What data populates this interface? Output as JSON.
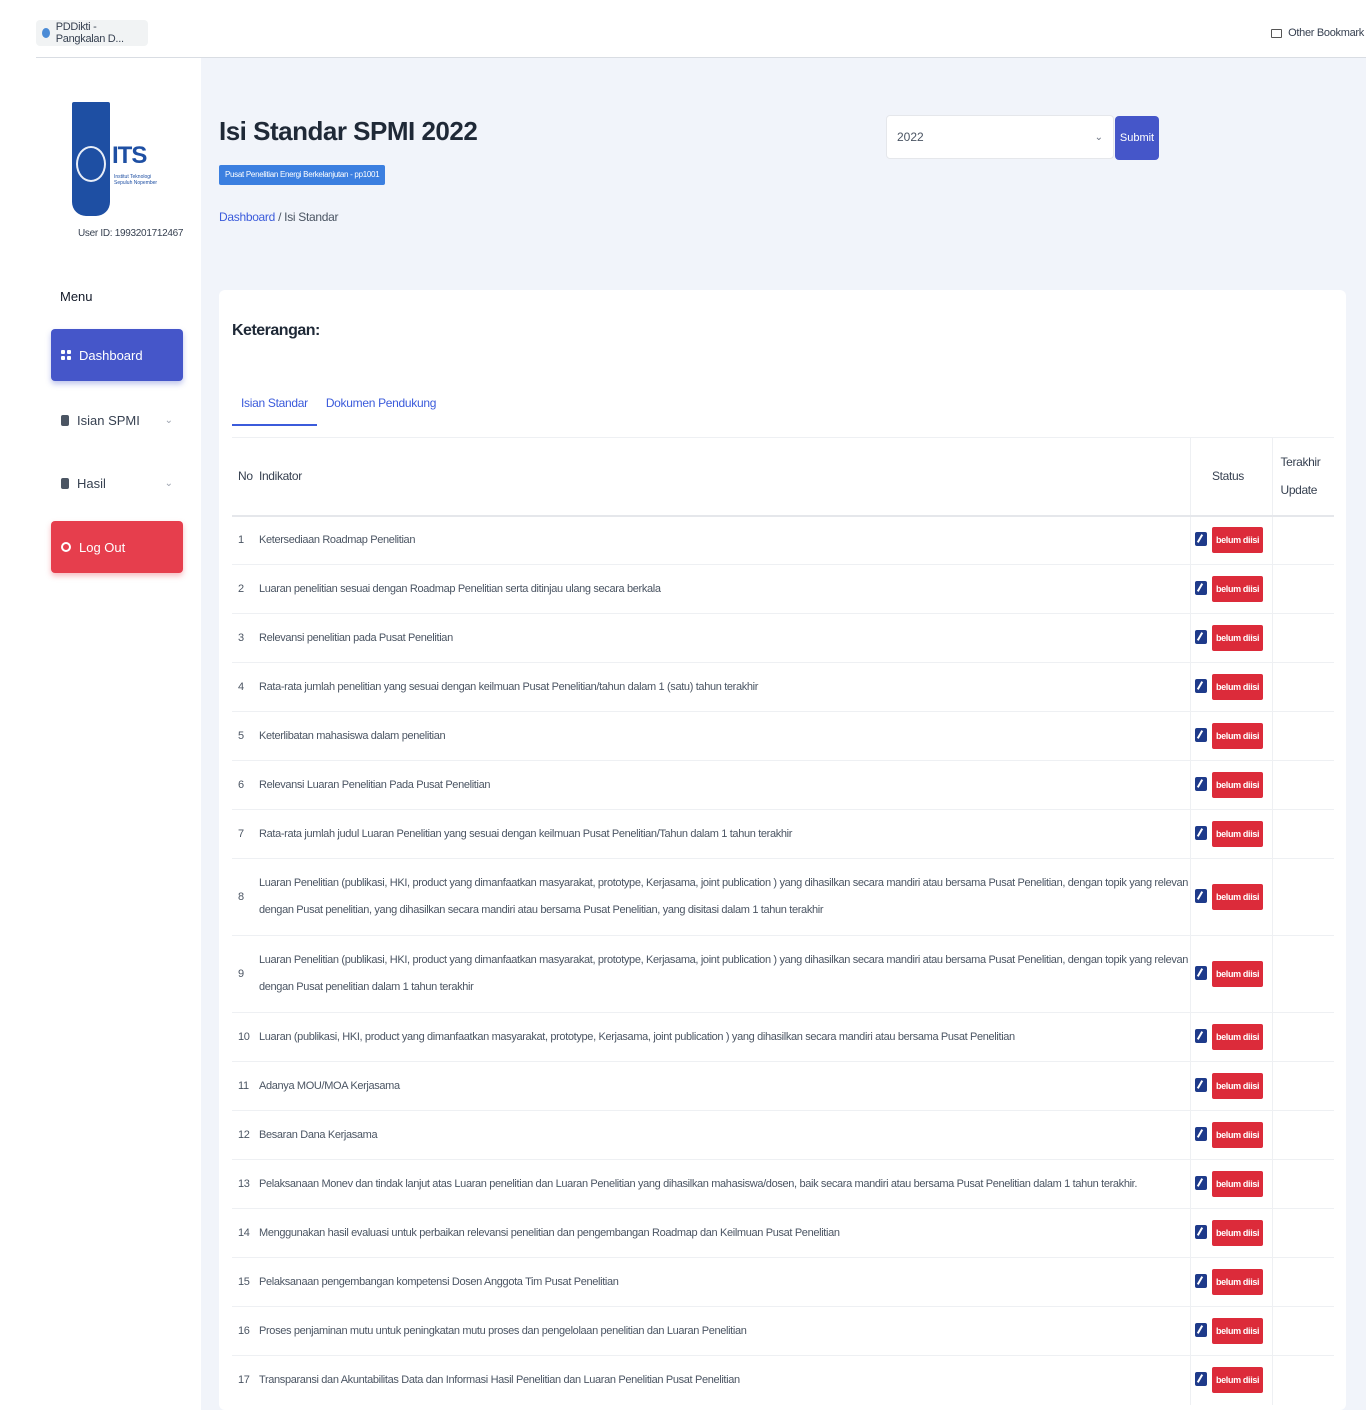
{
  "browser": {
    "tab_label": "PDDikti - Pangkalan D...",
    "bookmarks_label": "Other Bookmark"
  },
  "sidebar": {
    "logo_text": "ITS",
    "logo_subtitle": "Institut Teknologi Sepuluh Nopember",
    "user_id": "User ID: 1993201712467",
    "menu_label": "Menu",
    "items": [
      {
        "label": "Dashboard",
        "icon": "grid-icon",
        "active": true
      },
      {
        "label": "Isian SPMI",
        "icon": "file-icon",
        "has_submenu": true
      },
      {
        "label": "Hasil",
        "icon": "chart-icon",
        "has_submenu": true
      },
      {
        "label": "Log Out",
        "icon": "logout-icon"
      }
    ]
  },
  "header": {
    "title": "Isi Standar SPMI 2022",
    "unit_badge": "Pusat Penelitian Energi Berkelanjutan - pp1001",
    "breadcrumb": {
      "home": "Dashboard",
      "separator": "/",
      "current": "Isi Standar"
    },
    "year_select": {
      "value": "2022"
    },
    "submit_label": "Submit"
  },
  "card": {
    "title": "Keterangan:",
    "tabs": [
      {
        "label": "Isian Standar",
        "active": true
      },
      {
        "label": "Dokumen Pendukung",
        "active": false
      }
    ],
    "columns": {
      "no": "No",
      "indicator": "Indikator",
      "status": "Status",
      "last_update": "Terakhir Update"
    },
    "rows": [
      {
        "no": "1",
        "indicator": "Ketersediaan Roadmap Penelitian",
        "status": "belum diisi"
      },
      {
        "no": "2",
        "indicator": "Luaran penelitian sesuai dengan Roadmap Penelitian serta ditinjau ulang secara berkala",
        "status": "belum diisi"
      },
      {
        "no": "3",
        "indicator": "Relevansi penelitian pada Pusat Penelitian",
        "status": "belum diisi"
      },
      {
        "no": "4",
        "indicator": "Rata-rata jumlah penelitian yang sesuai dengan keilmuan Pusat Penelitian/tahun dalam 1 (satu) tahun terakhir",
        "status": "belum diisi"
      },
      {
        "no": "5",
        "indicator": "Keterlibatan mahasiswa dalam penelitian",
        "status": "belum diisi"
      },
      {
        "no": "6",
        "indicator": "Relevansi Luaran Penelitian Pada Pusat Penelitian",
        "status": "belum diisi"
      },
      {
        "no": "7",
        "indicator": "Rata-rata jumlah judul Luaran Penelitian yang sesuai dengan keilmuan Pusat Penelitian/Tahun dalam 1 tahun terakhir",
        "status": "belum diisi"
      },
      {
        "no": "8",
        "indicator": "Luaran Penelitian (publikasi, HKI, product yang dimanfaatkan masyarakat, prototype, Kerjasama, joint publication ) yang dihasilkan secara mandiri atau bersama Pusat Penelitian, dengan topik yang relevan dengan Pusat penelitian, yang dihasilkan secara mandiri atau bersama Pusat Penelitian, yang disitasi dalam 1 tahun terakhir",
        "status": "belum diisi"
      },
      {
        "no": "9",
        "indicator": "Luaran Penelitian (publikasi, HKI, product yang dimanfaatkan masyarakat, prototype, Kerjasama, joint publication ) yang dihasilkan secara mandiri atau bersama Pusat Penelitian, dengan topik yang relevan dengan Pusat penelitian dalam 1 tahun terakhir",
        "status": "belum diisi"
      },
      {
        "no": "10",
        "indicator": "Luaran (publikasi, HKI, product yang dimanfaatkan masyarakat, prototype, Kerjasama, joint publication ) yang dihasilkan secara mandiri atau bersama Pusat Penelitian",
        "status": "belum diisi"
      },
      {
        "no": "11",
        "indicator": "Adanya MOU/MOA Kerjasama",
        "status": "belum diisi"
      },
      {
        "no": "12",
        "indicator": "Besaran Dana Kerjasama",
        "status": "belum diisi"
      },
      {
        "no": "13",
        "indicator": "Pelaksanaan Monev dan tindak lanjut atas Luaran penelitian dan Luaran Penelitian yang dihasilkan mahasiswa/dosen, baik secara mandiri atau bersama Pusat Penelitian dalam 1 tahun terakhir.",
        "status": "belum diisi"
      },
      {
        "no": "14",
        "indicator": "Menggunakan hasil evaluasi untuk perbaikan relevansi penelitian dan pengembangan Roadmap dan Keilmuan Pusat Penelitian",
        "status": "belum diisi"
      },
      {
        "no": "15",
        "indicator": "Pelaksanaan pengembangan kompetensi Dosen Anggota Tim Pusat Penelitian",
        "status": "belum diisi"
      },
      {
        "no": "16",
        "indicator": "Proses penjaminan mutu untuk peningkatan mutu proses dan pengelolaan penelitian dan Luaran Penelitian",
        "status": "belum diisi"
      },
      {
        "no": "17",
        "indicator": "Transparansi dan Akuntabilitas Data dan Informasi Hasil Penelitian dan Luaran Penelitian Pusat Penelitian",
        "status": "belum diisi"
      }
    ]
  },
  "colors": {
    "primary": "#4556c9",
    "danger": "#e63e4d",
    "badge": "#dc2b3a",
    "main_bg": "#f1f4fa"
  }
}
